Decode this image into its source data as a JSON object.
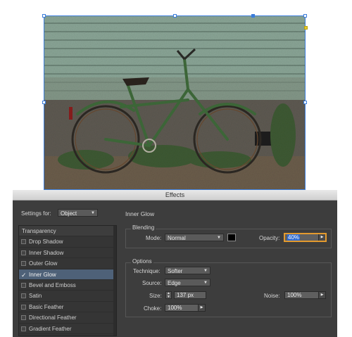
{
  "dialog": {
    "title": "Effects"
  },
  "settings": {
    "label": "Settings for:",
    "value": "Object"
  },
  "effects_list": {
    "header": "Transparency",
    "items": [
      {
        "label": "Drop Shadow",
        "checked": false
      },
      {
        "label": "Inner Shadow",
        "checked": false
      },
      {
        "label": "Outer Glow",
        "checked": false
      },
      {
        "label": "Inner Glow",
        "checked": true,
        "selected": true
      },
      {
        "label": "Bevel and Emboss",
        "checked": false
      },
      {
        "label": "Satin",
        "checked": false
      },
      {
        "label": "Basic Feather",
        "checked": false
      },
      {
        "label": "Directional Feather",
        "checked": false
      },
      {
        "label": "Gradient Feather",
        "checked": false
      }
    ]
  },
  "panel": {
    "title": "Inner Glow",
    "blending": {
      "legend": "Blending",
      "mode_label": "Mode:",
      "mode_value": "Normal",
      "color": "#000000",
      "opacity_label": "Opacity:",
      "opacity_value": "40%"
    },
    "options": {
      "legend": "Options",
      "technique_label": "Technique:",
      "technique_value": "Softer",
      "source_label": "Source:",
      "source_value": "Edge",
      "size_label": "Size:",
      "size_value": "137 px",
      "noise_label": "Noise:",
      "noise_value": "100%",
      "choke_label": "Choke:",
      "choke_value": "100%"
    }
  },
  "colors": {
    "accent": "#3b7ddb",
    "dialog_bg": "#3d3d3d",
    "selection": "#4e6178"
  }
}
